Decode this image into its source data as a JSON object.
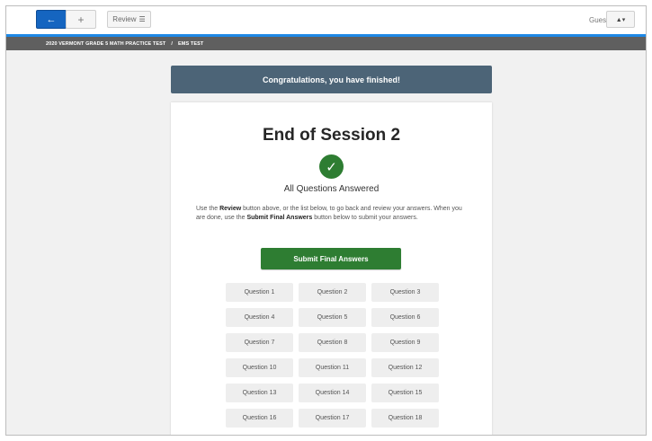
{
  "toolbar": {
    "back_glyph": "←",
    "add_glyph": "+",
    "review_label": "Review",
    "review_icon": "list-icon",
    "user_label": "Guest",
    "user_glyph": "▲▾"
  },
  "breadcrumb": {
    "test_name": "2020 VERMONT GRADE 5 MATH PRACTICE TEST",
    "separator": "/",
    "session": "EMS TEST"
  },
  "banner": {
    "text": "Congratulations, you have finished!"
  },
  "card": {
    "title": "End of Session 2",
    "check_glyph": "✓",
    "status": "All Questions Answered",
    "instructions": {
      "p1": "Use the ",
      "b1": "Review",
      "p2": " button above, or the list below, to go back and review your answers. When you are done, use the ",
      "b2": "Submit Final Answers",
      "p3": " button below to submit your answers."
    },
    "submit_label": "Submit Final Answers",
    "questions": [
      "Question 1",
      "Question 2",
      "Question 3",
      "Question 4",
      "Question 5",
      "Question 6",
      "Question 7",
      "Question 8",
      "Question 9",
      "Question 10",
      "Question 11",
      "Question 12",
      "Question 13",
      "Question 14",
      "Question 15",
      "Question 16",
      "Question 17",
      "Question 18"
    ]
  },
  "colors": {
    "back_button": "#1565c0",
    "accent_line": "#1e88e5",
    "breadcrumb_bg": "#5f5f5f",
    "banner_bg": "#4c6477",
    "success": "#2e7d32"
  }
}
